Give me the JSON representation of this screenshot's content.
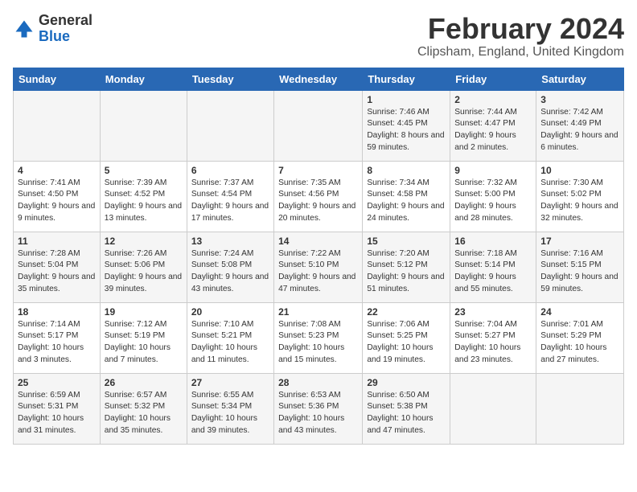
{
  "header": {
    "logo_general": "General",
    "logo_blue": "Blue",
    "month": "February 2024",
    "location": "Clipsham, England, United Kingdom"
  },
  "days_of_week": [
    "Sunday",
    "Monday",
    "Tuesday",
    "Wednesday",
    "Thursday",
    "Friday",
    "Saturday"
  ],
  "weeks": [
    [
      {
        "day": "",
        "info": ""
      },
      {
        "day": "",
        "info": ""
      },
      {
        "day": "",
        "info": ""
      },
      {
        "day": "",
        "info": ""
      },
      {
        "day": "1",
        "info": "Sunrise: 7:46 AM\nSunset: 4:45 PM\nDaylight: 8 hours and 59 minutes."
      },
      {
        "day": "2",
        "info": "Sunrise: 7:44 AM\nSunset: 4:47 PM\nDaylight: 9 hours and 2 minutes."
      },
      {
        "day": "3",
        "info": "Sunrise: 7:42 AM\nSunset: 4:49 PM\nDaylight: 9 hours and 6 minutes."
      }
    ],
    [
      {
        "day": "4",
        "info": "Sunrise: 7:41 AM\nSunset: 4:50 PM\nDaylight: 9 hours and 9 minutes."
      },
      {
        "day": "5",
        "info": "Sunrise: 7:39 AM\nSunset: 4:52 PM\nDaylight: 9 hours and 13 minutes."
      },
      {
        "day": "6",
        "info": "Sunrise: 7:37 AM\nSunset: 4:54 PM\nDaylight: 9 hours and 17 minutes."
      },
      {
        "day": "7",
        "info": "Sunrise: 7:35 AM\nSunset: 4:56 PM\nDaylight: 9 hours and 20 minutes."
      },
      {
        "day": "8",
        "info": "Sunrise: 7:34 AM\nSunset: 4:58 PM\nDaylight: 9 hours and 24 minutes."
      },
      {
        "day": "9",
        "info": "Sunrise: 7:32 AM\nSunset: 5:00 PM\nDaylight: 9 hours and 28 minutes."
      },
      {
        "day": "10",
        "info": "Sunrise: 7:30 AM\nSunset: 5:02 PM\nDaylight: 9 hours and 32 minutes."
      }
    ],
    [
      {
        "day": "11",
        "info": "Sunrise: 7:28 AM\nSunset: 5:04 PM\nDaylight: 9 hours and 35 minutes."
      },
      {
        "day": "12",
        "info": "Sunrise: 7:26 AM\nSunset: 5:06 PM\nDaylight: 9 hours and 39 minutes."
      },
      {
        "day": "13",
        "info": "Sunrise: 7:24 AM\nSunset: 5:08 PM\nDaylight: 9 hours and 43 minutes."
      },
      {
        "day": "14",
        "info": "Sunrise: 7:22 AM\nSunset: 5:10 PM\nDaylight: 9 hours and 47 minutes."
      },
      {
        "day": "15",
        "info": "Sunrise: 7:20 AM\nSunset: 5:12 PM\nDaylight: 9 hours and 51 minutes."
      },
      {
        "day": "16",
        "info": "Sunrise: 7:18 AM\nSunset: 5:14 PM\nDaylight: 9 hours and 55 minutes."
      },
      {
        "day": "17",
        "info": "Sunrise: 7:16 AM\nSunset: 5:15 PM\nDaylight: 9 hours and 59 minutes."
      }
    ],
    [
      {
        "day": "18",
        "info": "Sunrise: 7:14 AM\nSunset: 5:17 PM\nDaylight: 10 hours and 3 minutes."
      },
      {
        "day": "19",
        "info": "Sunrise: 7:12 AM\nSunset: 5:19 PM\nDaylight: 10 hours and 7 minutes."
      },
      {
        "day": "20",
        "info": "Sunrise: 7:10 AM\nSunset: 5:21 PM\nDaylight: 10 hours and 11 minutes."
      },
      {
        "day": "21",
        "info": "Sunrise: 7:08 AM\nSunset: 5:23 PM\nDaylight: 10 hours and 15 minutes."
      },
      {
        "day": "22",
        "info": "Sunrise: 7:06 AM\nSunset: 5:25 PM\nDaylight: 10 hours and 19 minutes."
      },
      {
        "day": "23",
        "info": "Sunrise: 7:04 AM\nSunset: 5:27 PM\nDaylight: 10 hours and 23 minutes."
      },
      {
        "day": "24",
        "info": "Sunrise: 7:01 AM\nSunset: 5:29 PM\nDaylight: 10 hours and 27 minutes."
      }
    ],
    [
      {
        "day": "25",
        "info": "Sunrise: 6:59 AM\nSunset: 5:31 PM\nDaylight: 10 hours and 31 minutes."
      },
      {
        "day": "26",
        "info": "Sunrise: 6:57 AM\nSunset: 5:32 PM\nDaylight: 10 hours and 35 minutes."
      },
      {
        "day": "27",
        "info": "Sunrise: 6:55 AM\nSunset: 5:34 PM\nDaylight: 10 hours and 39 minutes."
      },
      {
        "day": "28",
        "info": "Sunrise: 6:53 AM\nSunset: 5:36 PM\nDaylight: 10 hours and 43 minutes."
      },
      {
        "day": "29",
        "info": "Sunrise: 6:50 AM\nSunset: 5:38 PM\nDaylight: 10 hours and 47 minutes."
      },
      {
        "day": "",
        "info": ""
      },
      {
        "day": "",
        "info": ""
      }
    ]
  ]
}
